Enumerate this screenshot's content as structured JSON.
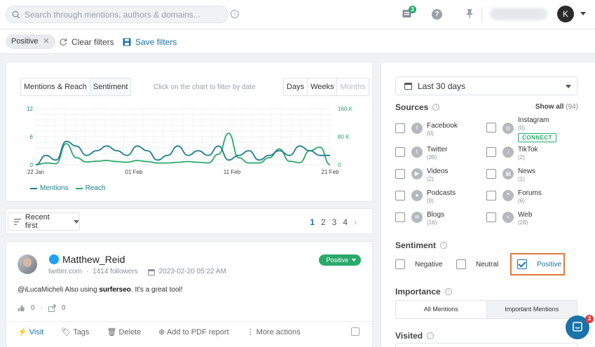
{
  "topbar": {
    "search_placeholder": "Search through mentions, authors & domains...",
    "notifications_count": "3",
    "user_initial": "K"
  },
  "filters": {
    "active_chip": "Positive",
    "clear_label": "Clear filters",
    "save_label": "Save filters"
  },
  "chart_panel": {
    "tabs": [
      "Mentions & Reach",
      "Sentiment"
    ],
    "hint": "Click on the chart to filter by date",
    "range_tabs": [
      "Days",
      "Weeks",
      "Months"
    ],
    "legend": [
      "Mentions",
      "Reach"
    ]
  },
  "chart_data": {
    "type": "line",
    "x_ticks": [
      "22 Jan",
      "01 Feb",
      "11 Feb",
      "21 Feb"
    ],
    "y_left_ticks": [
      "12",
      "6",
      "0"
    ],
    "y_right_ticks": [
      "160.K",
      "80 K",
      "0"
    ],
    "ylim_left": [
      0,
      12
    ],
    "ylim_right": [
      0,
      160000
    ],
    "grid": true,
    "series": [
      {
        "name": "Mentions",
        "color": "#1f7f8c",
        "values": [
          0,
          2,
          1,
          5,
          4,
          2,
          3,
          4,
          3,
          2,
          4,
          3,
          1,
          2,
          4,
          2,
          3,
          2,
          4,
          1,
          2,
          3,
          1,
          2,
          3,
          2,
          4,
          3,
          2,
          2
        ]
      },
      {
        "name": "Reach",
        "color": "#2aa96a",
        "values": [
          0,
          5000,
          3000,
          60000,
          20000,
          8000,
          10000,
          12000,
          9000,
          7000,
          12000,
          9000,
          5000,
          5000,
          7000,
          9000,
          7000,
          5000,
          30000,
          90000,
          20000,
          5000,
          5000,
          20000,
          45000,
          10000,
          6000,
          40000,
          50000,
          0
        ]
      }
    ]
  },
  "sort": {
    "label": "Recent first",
    "pages": [
      "1",
      "2",
      "3",
      "4"
    ]
  },
  "mention": {
    "author": "Matthew_Reid",
    "domain": "twitter.com",
    "followers": "1414 followers",
    "date": "2023-02-20 05:22 AM",
    "sentiment": "Positive",
    "text_before": "@iLucaMicheli Also using ",
    "text_bold": "surferseo",
    "text_after": ". It's a great tool!",
    "likes": "0",
    "shares": "0",
    "actions": [
      "Visit",
      "Tags",
      "Delete",
      "Add to PDF report",
      "More actions"
    ]
  },
  "sidebar": {
    "date_range": "Last 30 days",
    "sources_title": "Sources",
    "show_all": "Show all",
    "show_all_count": "(94)",
    "sources": [
      {
        "name": "Facebook",
        "count": "(0)"
      },
      {
        "name": "Instagram",
        "count": "(0)",
        "connect": "CONNECT"
      },
      {
        "name": "Twitter",
        "count": "(39)"
      },
      {
        "name": "TikTok",
        "count": "(2)"
      },
      {
        "name": "Videos",
        "count": "(2)"
      },
      {
        "name": "News",
        "count": "(1)"
      },
      {
        "name": "Podcasts",
        "count": "(0)"
      },
      {
        "name": "Forums",
        "count": "(6)"
      },
      {
        "name": "Blogs",
        "count": "(16)"
      },
      {
        "name": "Web",
        "count": "(28)"
      }
    ],
    "sentiment_title": "Sentiment",
    "sentiments": [
      "Negative",
      "Neutral",
      "Positive"
    ],
    "importance_title": "Importance",
    "importance_tabs": [
      "All Mentions",
      "Important Mentions"
    ],
    "visited_title": "Visited"
  },
  "chat": {
    "badge": "3"
  }
}
